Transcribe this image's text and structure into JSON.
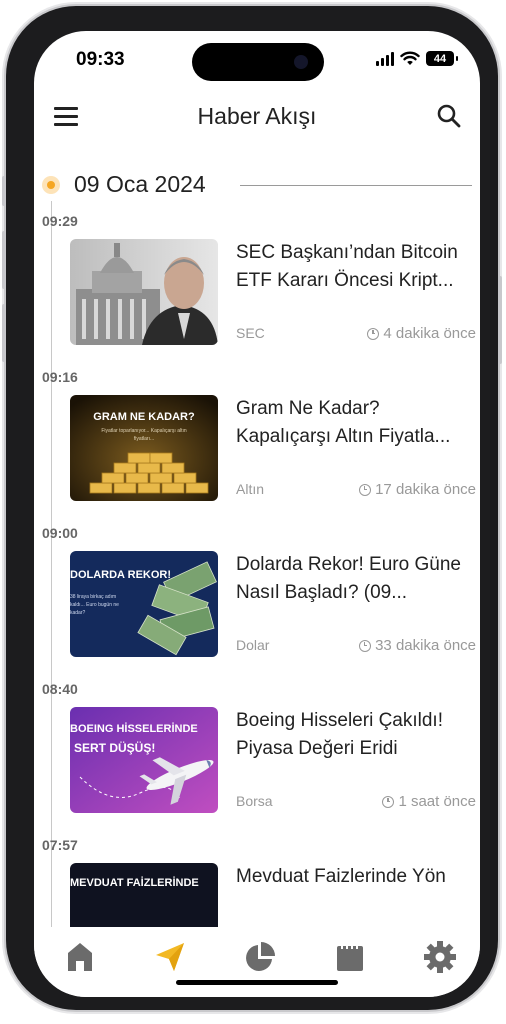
{
  "status_bar": {
    "time": "09:33",
    "battery": "44"
  },
  "app_bar": {
    "title": "Haber Akışı",
    "menu_icon": "menu-icon",
    "search_icon": "search-icon"
  },
  "feed": {
    "date": "09 Oca 2024",
    "items": [
      {
        "time": "09:29",
        "headline": "SEC Başkanı’ndan Bitcoin ETF Kararı Öncesi Kript...",
        "tag": "SEC",
        "ago": "4 dakika önce",
        "thumb_text": ""
      },
      {
        "time": "09:16",
        "headline": "Gram Ne Kadar? Kapalıçarşı Altın Fiyatla...",
        "tag": "Altın",
        "ago": "17 dakika önce",
        "thumb_text": "GRAM NE KADAR?",
        "thumb_sub": "Fiyatlar toparlanıyor... Kapalıçarşı altın fiyatları..."
      },
      {
        "time": "09:00",
        "headline": "Dolarda Rekor! Euro Güne Nasıl Başladı? (09...",
        "tag": "Dolar",
        "ago": "33 dakika önce",
        "thumb_text": "DOLARDA REKOR!",
        "thumb_sub": "38 liraya birkaç adım kaldı... Euro bugün ne kadar?"
      },
      {
        "time": "08:40",
        "headline": "Boeing Hisseleri Çakıldı! Piyasa Değeri Eridi",
        "tag": "Borsa",
        "ago": "1 saat önce",
        "thumb_text": "BOEING HİSSELERİNDE",
        "thumb_sub": "SERT DÜŞÜŞ!"
      },
      {
        "time": "07:57",
        "headline": "Mevduat Faizlerinde Yön",
        "tag": "",
        "ago": "",
        "thumb_text": "MEVDUAT FAİZLERİNDE"
      }
    ]
  },
  "tab_bar": {
    "tabs": [
      {
        "icon": "home-icon"
      },
      {
        "icon": "send-icon"
      },
      {
        "icon": "pie-chart-icon"
      },
      {
        "icon": "calendar-icon"
      },
      {
        "icon": "gear-icon"
      }
    ]
  },
  "colors": {
    "accent": "#f5a623",
    "tab_gray": "#6b6b6b",
    "send_yellow": "#f2b824"
  }
}
